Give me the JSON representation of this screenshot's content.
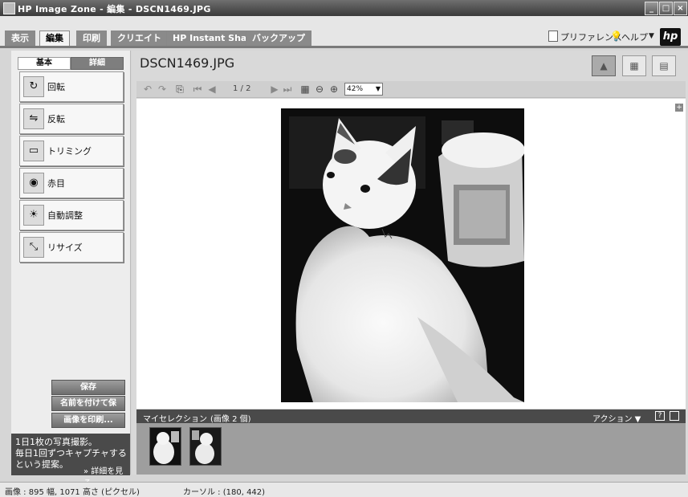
{
  "window": {
    "title": "HP Image Zone - 編集 - DSCN1469.JPG",
    "controls": [
      "_",
      "□",
      "×"
    ]
  },
  "tabs": [
    {
      "label": "表示",
      "active": false
    },
    {
      "label": "編集",
      "active": true
    },
    {
      "label": "印刷",
      "active": false
    },
    {
      "label": "クリエイト",
      "active": false
    },
    {
      "label": "HP Instant Share",
      "active": false
    },
    {
      "label": "バックアップ",
      "active": false
    }
  ],
  "header_links": {
    "preferences": "プリファレンス",
    "help": "ヘルプ",
    "help_arrow": "▼",
    "logo": "hp"
  },
  "left_panel": {
    "subtabs": [
      "基本",
      "詳細"
    ],
    "tools": [
      {
        "label": "回転",
        "icon": "rotate-icon"
      },
      {
        "label": "反転",
        "icon": "flip-icon"
      },
      {
        "label": "トリミング",
        "icon": "crop-icon"
      },
      {
        "label": "赤目",
        "icon": "red-eye-icon"
      },
      {
        "label": "自動調整",
        "icon": "auto-adjust-icon"
      },
      {
        "label": "リサイズ",
        "icon": "resize-icon"
      }
    ],
    "actions": {
      "save": "保存",
      "save_as": "名前を付けて保存...",
      "print": "画像を印刷..."
    },
    "tip": {
      "text": "1日1枚の写真撮影。\n毎日1回ずつキャプチャするという提案。",
      "link": "» 詳細を見る"
    }
  },
  "main": {
    "filename": "DSCN1469.JPG",
    "toolbar": {
      "page_indicator": "1 / 2",
      "zoom": "42%",
      "zoom_arrow": "▼"
    },
    "collection": {
      "title": "マイセレクション",
      "count": "(画像 2 個)",
      "actions": "アクション ▼",
      "help": "?"
    }
  },
  "status": {
    "image_info": "画像 : 895 幅, 1071 高さ (ピクセル)",
    "cursor": "カーソル : (180, 442)"
  },
  "colors": {
    "titlebar": "#4a4a4a",
    "panel": "#ededed",
    "canvas": "#ffffff",
    "collection_bar": "#4a4a4a"
  }
}
